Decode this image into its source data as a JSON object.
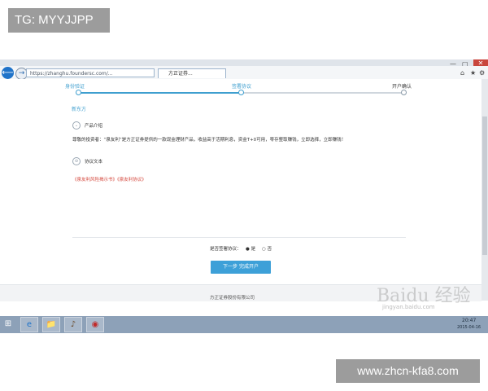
{
  "overlay_tag": "TG: MYYJJPP",
  "overlay_url": "www.zhcn-kfa8.com",
  "browser": {
    "back_glyph": "⟵",
    "address": "https://zhanghu.foundersc.com/...",
    "tab_title": "方正证券...",
    "window_controls": [
      "—",
      "▢"
    ],
    "close_glyph": "✕",
    "toolbar_icons": [
      "⌂",
      "★",
      "⚙"
    ]
  },
  "steps": [
    {
      "label": "身份验证"
    },
    {
      "label": "签署协议"
    },
    {
      "label": "开户确认"
    }
  ],
  "section_title": "新东方",
  "product_intro": {
    "title": "产品介绍",
    "text": "尊敬的投资者：“泉友利”是方正证券提供的一款现金理财产品，收益高于活期利息，资金T+0可用，零存整取赚钱，立即选择，立即赚钱！"
  },
  "agreement": {
    "title": "协议文本",
    "links": "《泉友利风险揭示书》《泉友利协议》"
  },
  "consent": {
    "question": "是否签署协议：",
    "option_yes": "是",
    "option_no": "否"
  },
  "next_button": "下一步 完成开户",
  "footer": "方正证券股份有限公司",
  "watermark": "Baidu 经验",
  "watermark_sub": "jingyan.baidu.com",
  "taskbar": {
    "start_glyph": "⊞",
    "apps": [
      "e",
      "📁",
      "♪",
      "◉"
    ],
    "clock_time": "20:47",
    "clock_date": "2015-04-16"
  },
  "colors": {
    "accent": "#3f9fcf",
    "warning": "#d4463b",
    "taskbar": "#8da1b8"
  }
}
